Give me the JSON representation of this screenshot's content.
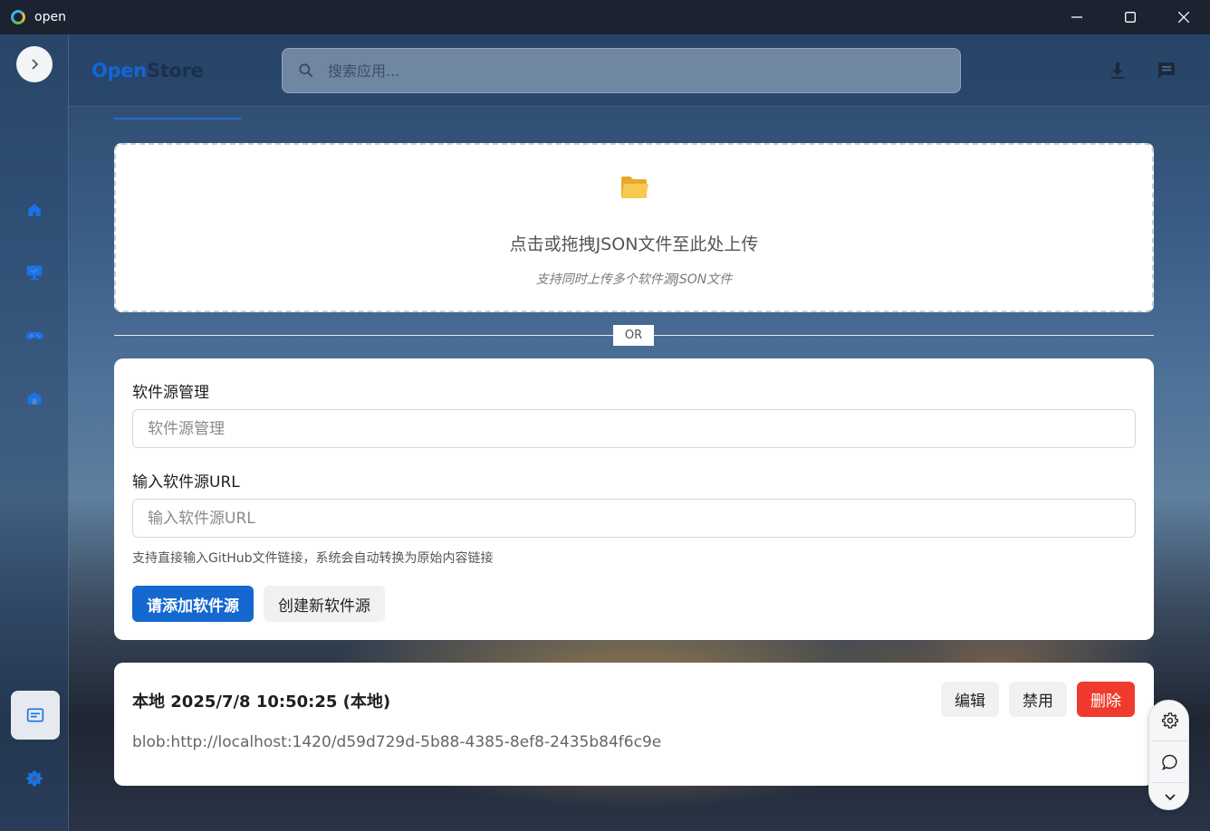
{
  "window": {
    "title": "open",
    "icons": [
      "app-logo-icon",
      "minimize-icon",
      "maximize-icon",
      "close-icon"
    ]
  },
  "header": {
    "brand_part1": "Open",
    "brand_part2": "Store",
    "search_placeholder": "搜索应用...",
    "icons": [
      "download-icon",
      "feedback-icon"
    ]
  },
  "sidebar": {
    "icons": [
      "chevron-right-icon",
      "home-icon",
      "monitor-icon",
      "gamepad-icon",
      "store-icon",
      "source-manage-icon",
      "gear-icon"
    ]
  },
  "upload": {
    "main_text": "点击或拖拽JSON文件至此处上传",
    "sub_text": "支持同时上传多个软件源JSON文件"
  },
  "divider": {
    "label": "OR"
  },
  "form": {
    "name_label": "软件源管理",
    "name_placeholder": "软件源管理",
    "url_label": "输入软件源URL",
    "url_placeholder": "输入软件源URL",
    "hint": "支持直接输入GitHub文件链接，系统会自动转换为原始内容链接",
    "add_button": "请添加软件源",
    "create_button": "创建新软件源"
  },
  "sources": [
    {
      "title": "本地 2025/7/8 10:50:25 (本地)",
      "url": "blob:http://localhost:1420/d59d729d-5b88-4385-8ef8-2435b84f6c9e",
      "edit_label": "编辑",
      "disable_label": "禁用",
      "delete_label": "删除"
    }
  ],
  "fab": {
    "icons": [
      "settings-icon",
      "chat-icon",
      "chevron-down-icon"
    ]
  },
  "colors": {
    "accent": "#1468d0",
    "danger": "#f03a2e",
    "nav_icon": "#1a73e8"
  }
}
